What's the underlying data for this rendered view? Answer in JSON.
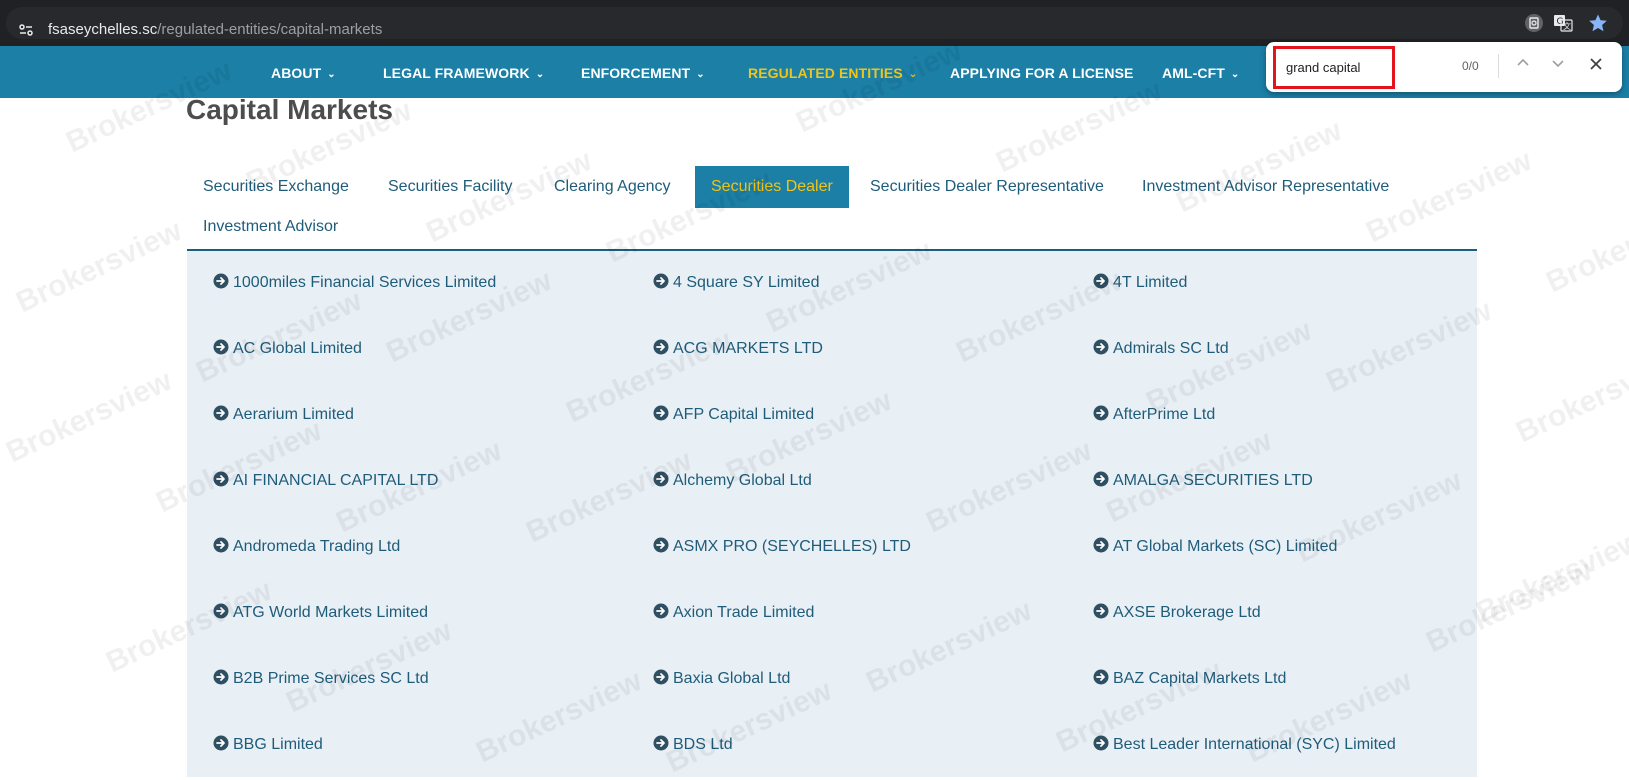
{
  "browser": {
    "url_host": "fsaseychelles.sc",
    "url_path": "/regulated-entities/capital-markets"
  },
  "nav": {
    "items": [
      {
        "label": "ABOUT",
        "has_dropdown": true
      },
      {
        "label": "LEGAL FRAMEWORK",
        "has_dropdown": true
      },
      {
        "label": "ENFORCEMENT",
        "has_dropdown": true
      },
      {
        "label": "REGULATED ENTITIES",
        "has_dropdown": true,
        "active": true
      },
      {
        "label": "APPLYING FOR A LICENSE",
        "has_dropdown": false
      },
      {
        "label": "AML-CFT",
        "has_dropdown": true
      }
    ]
  },
  "find_bar": {
    "query": "grand capital",
    "count": "0/0"
  },
  "page": {
    "title": "Capital Markets"
  },
  "tabs": [
    {
      "label": "Securities Exchange"
    },
    {
      "label": "Securities Facility"
    },
    {
      "label": "Clearing Agency"
    },
    {
      "label": "Securities Dealer",
      "active": true
    },
    {
      "label": "Securities Dealer Representative"
    },
    {
      "label": "Investment Advisor Representative"
    },
    {
      "label": "Investment Advisor"
    }
  ],
  "entities": [
    "1000miles Financial Services Limited",
    "4 Square SY Limited",
    "4T Limited",
    "AC Global Limited",
    "ACG MARKETS LTD",
    "Admirals SC Ltd",
    "Aerarium Limited",
    "AFP Capital Limited",
    "AfterPrime Ltd",
    "AI FINANCIAL CAPITAL LTD",
    "Alchemy Global Ltd",
    "AMALGA SECURITIES LTD",
    "Andromeda Trading Ltd",
    "ASMX PRO (SEYCHELLES) LTD",
    "AT Global Markets (SC) Limited",
    "ATG World Markets Limited",
    "Axion Trade Limited",
    "AXSE Brokerage Ltd",
    "B2B Prime Services SC Ltd",
    "Baxia Global Ltd",
    "BAZ Capital Markets Ltd",
    "BBG Limited",
    "BDS Ltd",
    "Best Leader International (SYC) Limited"
  ],
  "watermark": "Brokersview",
  "colors": {
    "nav_bg": "#1b7fa6",
    "active_text": "#f0c419",
    "link": "#1f5c7a",
    "panel_bg": "#e9f0f5",
    "find_highlight": "#e3141c"
  }
}
